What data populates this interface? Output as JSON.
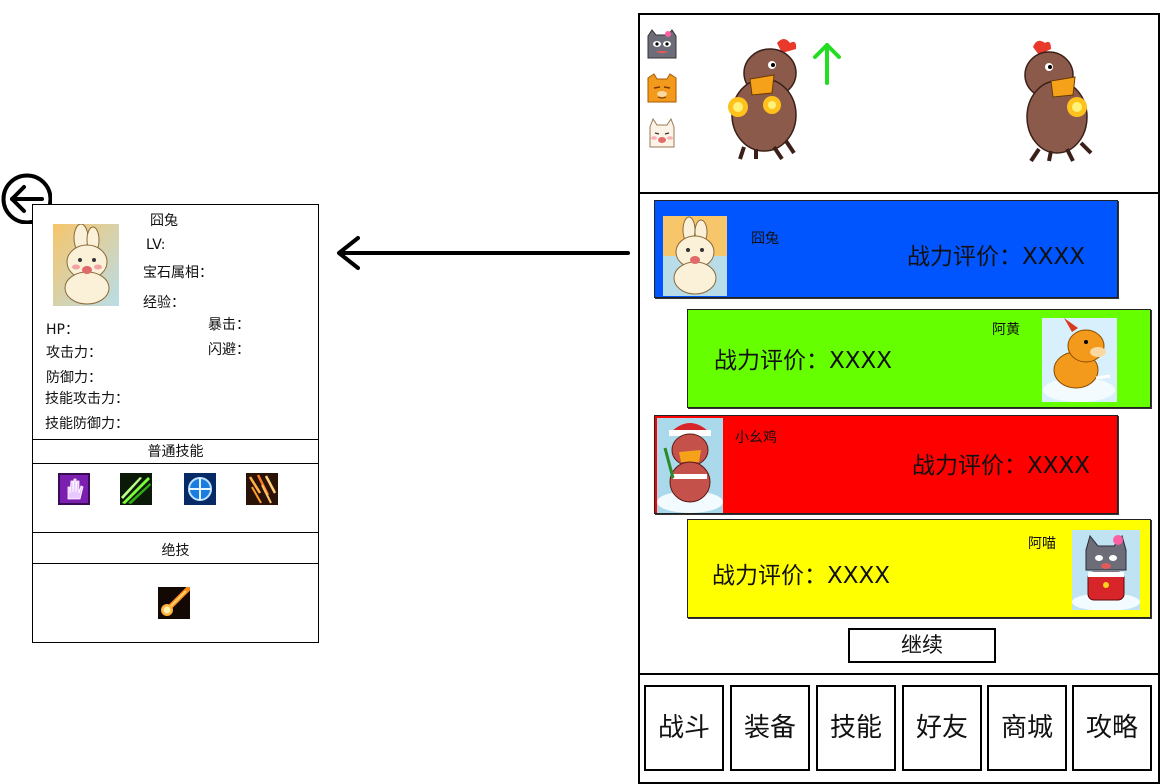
{
  "detail_panel": {
    "pet_name": "囧兔",
    "level_label": "LV:",
    "gem_attribute_label": "宝石属相：",
    "exp_label": "经验：",
    "stats_left": [
      "HP：",
      "攻击力：",
      "防御力：",
      "技能攻击力：",
      "技能防御力："
    ],
    "stats_right": [
      "暴击：",
      "闪避："
    ],
    "normal_skills_title": "普通技能",
    "ultimate_title": "绝技",
    "normal_skill_icons": [
      "purple-hand-icon",
      "green-slash-icon",
      "blue-target-icon",
      "fire-rain-icon"
    ],
    "ultimate_icon": "meteor-icon"
  },
  "phone": {
    "team": [
      {
        "name": "囧兔",
        "power": "战力评价：XXXX",
        "color": "#0055ff",
        "avatar": "rabbit-avatar"
      },
      {
        "name": "阿黄",
        "power": "战力评价：XXXX",
        "color": "#66ff00",
        "avatar": "dog-avatar"
      },
      {
        "name": "小幺鸡",
        "power": "战力评价：XXXX",
        "color": "#ff0000",
        "avatar": "chicken-avatar"
      },
      {
        "name": "阿喵",
        "power": "战力评价：XXXX",
        "color": "#ffff00",
        "avatar": "cat-avatar"
      }
    ],
    "continue_label": "继续",
    "nav": [
      "战斗",
      "装备",
      "技能",
      "好友",
      "商城",
      "攻略"
    ],
    "level_up_color": "#22dd22"
  }
}
